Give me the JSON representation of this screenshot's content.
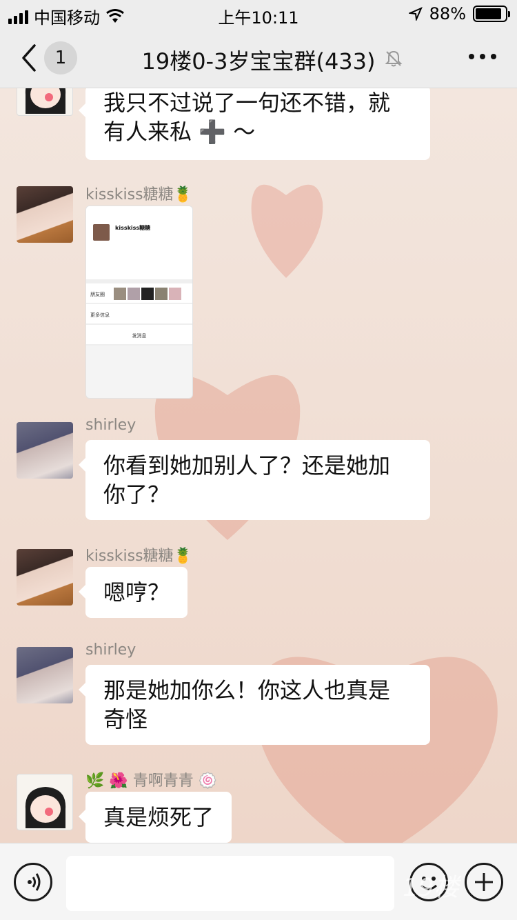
{
  "status_bar": {
    "carrier": "中国移动",
    "time": "上午10:11",
    "battery_percent": "88%",
    "battery_level": 0.88
  },
  "nav": {
    "unread_count": "1",
    "title": "19楼0-3岁宝宝群(433)"
  },
  "messages": [
    {
      "sender": "",
      "text_lines": [
        "我只不过说了一句还不错，就",
        "有人来私 ➕ ～"
      ]
    },
    {
      "sender": "kisskiss糖糖🍍",
      "type": "image",
      "image_inner": {
        "name": "kisskiss糖糖",
        "row1": "朋友圈",
        "row2": "更多信息",
        "row3": "发消息"
      }
    },
    {
      "sender": "shirley",
      "text_lines": [
        "你看到她加别人了？还是她加",
        "你了？"
      ]
    },
    {
      "sender": "kisskiss糖糖🍍",
      "text_lines": [
        "嗯哼？"
      ]
    },
    {
      "sender": "shirley",
      "text_lines": [
        "那是她加你么！你这人也真是",
        "奇怪"
      ]
    },
    {
      "sender": "🌿 🌺 青啊青青 🍥",
      "text_lines": [
        "真是烦死了"
      ]
    }
  ],
  "input_bar": {
    "voice_icon": "voice-icon",
    "emoji_icon": "emoji-icon",
    "plus_icon": "plus-icon"
  },
  "watermark": "19楼"
}
